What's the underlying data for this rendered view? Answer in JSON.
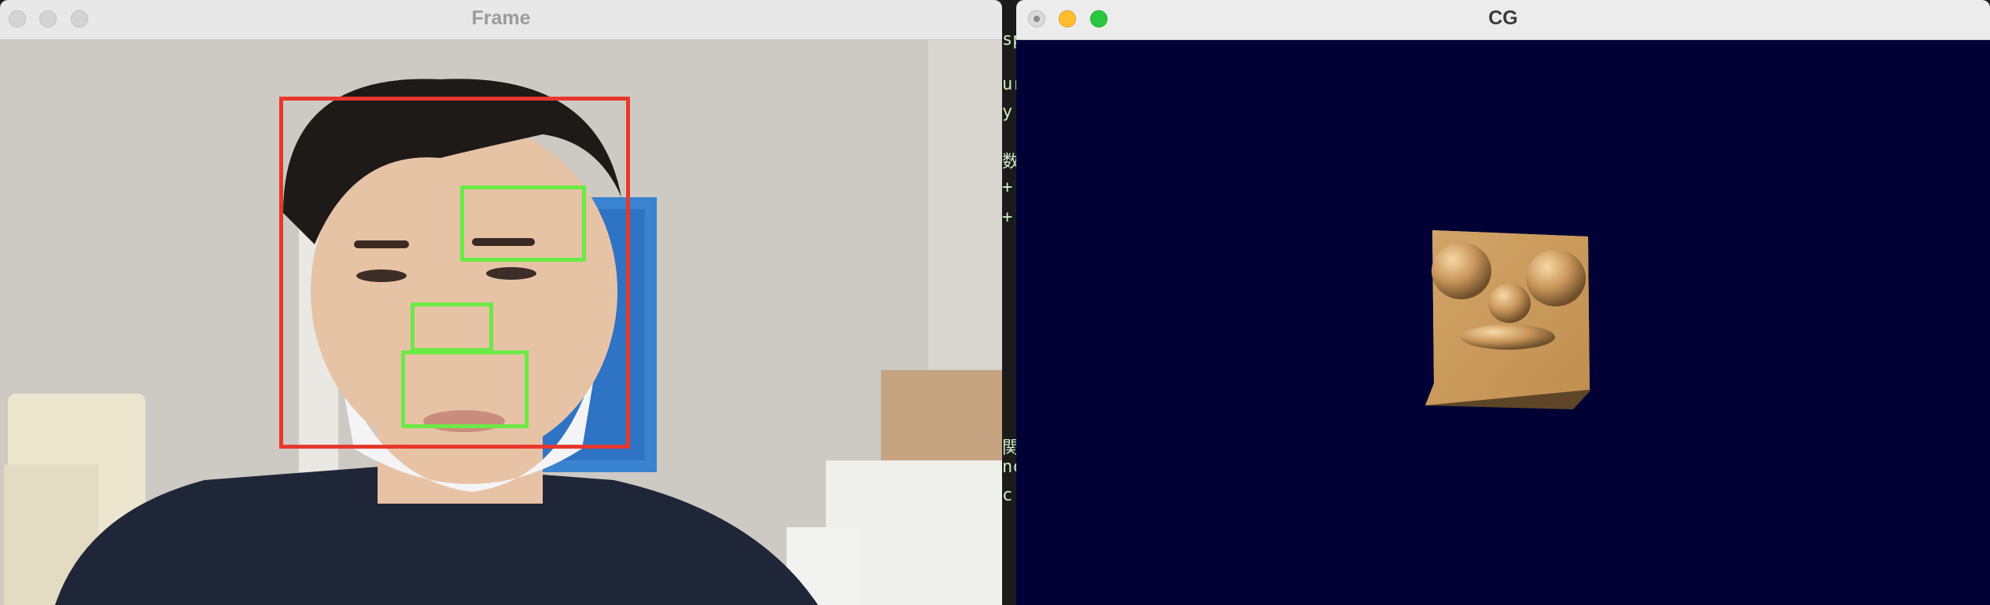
{
  "windows": {
    "frame": {
      "title": "Frame",
      "detections": [
        {
          "label": "face",
          "color": "#e8372c"
        },
        {
          "label": "eye",
          "color": "#6bea45"
        },
        {
          "label": "nose",
          "color": "#6bea45"
        },
        {
          "label": "mouth",
          "color": "#6bea45"
        }
      ]
    },
    "cg": {
      "title": "CG",
      "background_color": "#020135",
      "model": {
        "face_color": "#c8955a",
        "shadow_color": "#5e4527"
      }
    }
  },
  "background_editor": {
    "fragments": [
      "sp",
      "ur",
      "y",
      "数を",
      "+",
      "+",
      "関数",
      "nc",
      "c"
    ]
  }
}
